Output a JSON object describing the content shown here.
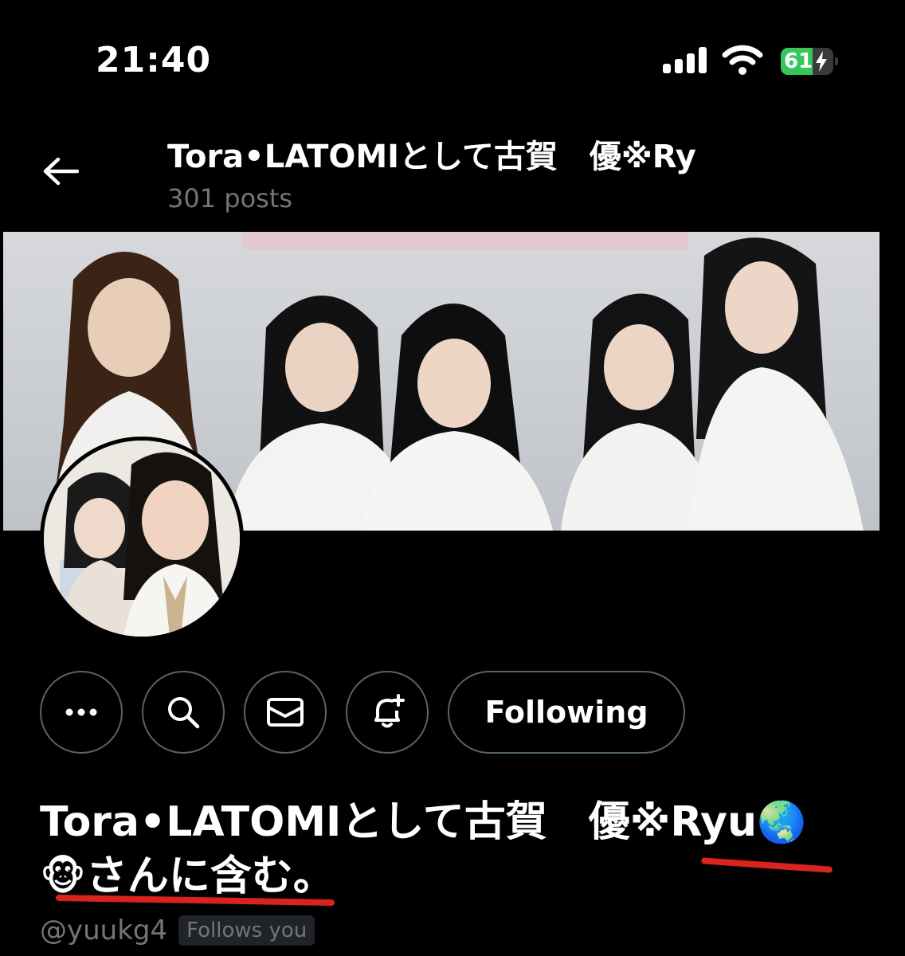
{
  "status_bar": {
    "time": "21:40",
    "battery_level": "61",
    "battery_color": "#34c759"
  },
  "header": {
    "back_icon": "arrow-left-icon",
    "title": "Tora•LATOMIとして古賀　優※Ry",
    "posts_count": "301 posts"
  },
  "actions": {
    "more_icon": "more-horizontal-icon",
    "search_icon": "search-icon",
    "message_icon": "envelope-icon",
    "notify_icon": "bell-plus-icon",
    "following_label": "Following"
  },
  "profile": {
    "name_line1": "Tora•LATOMIとして古賀　優※Ryu",
    "name_emoji1": "🌏",
    "name_emoji2": "🐵",
    "name_line2": "さんに含む。",
    "handle": "@yuukg4",
    "follows_you": "Follows you"
  },
  "colors": {
    "background": "#000000",
    "muted_text": "#71767b",
    "button_border": "#536471",
    "annotation_underline": "#d8231e"
  }
}
